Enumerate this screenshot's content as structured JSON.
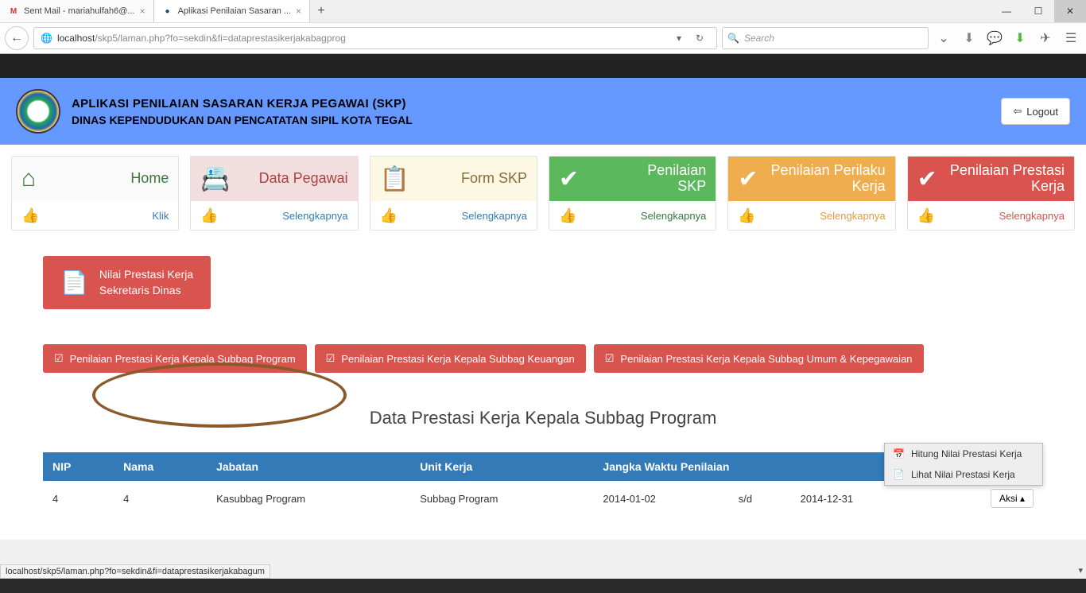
{
  "browser": {
    "tabs": [
      {
        "title": "Sent Mail - mariahulfah6@...",
        "icon": "M"
      },
      {
        "title": "Aplikasi Penilaian Sasaran ...",
        "icon": "●"
      }
    ],
    "url_host": "localhost",
    "url_path": "/skp5/laman.php?fo=sekdin&fi=dataprestasikerjakabagprog",
    "search_placeholder": "Search",
    "statusbar": "localhost/skp5/laman.php?fo=sekdin&fi=dataprestasikerjakabagum"
  },
  "header": {
    "line1": "APLIKASI PENILAIAN SASARAN KERJA PEGAWAI (SKP)",
    "line2": "DINAS KEPENDUDUKAN DAN PENCATATAN SIPIL KOTA TEGAL",
    "logout": "Logout"
  },
  "cards": [
    {
      "title": "Home",
      "link": "Klik",
      "cls": "c-green",
      "icon": "⌂"
    },
    {
      "title": "Data Pegawai",
      "link": "Selengkapnya",
      "cls": "c-red",
      "icon": "📇"
    },
    {
      "title": "Form SKP",
      "link": "Selengkapnya",
      "cls": "c-yellow",
      "icon": "📋"
    },
    {
      "title": "Penilaian SKP",
      "link": "Selengkapnya",
      "cls": "c-success",
      "icon": "✔"
    },
    {
      "title": "Penilaian Perilaku Kerja",
      "link": "Selengkapnya",
      "cls": "c-warn",
      "icon": "✔"
    },
    {
      "title": "Penilaian Prestasi Kerja",
      "link": "Selengkapnya",
      "cls": "c-danger",
      "icon": "✔"
    }
  ],
  "chip": {
    "line1": "Nilai Prestasi Kerja",
    "line2": "Sekretaris Dinas"
  },
  "tabsrow": [
    "Penilaian Prestasi Kerja Kepala Subbag Program",
    "Penilaian Prestasi Kerja Kepala Subbag Keuangan",
    "Penilaian Prestasi Kerja Kepala Subbag Umum & Kepegawaian"
  ],
  "section_title": "Data Prestasi Kerja Kepala Subbag Program",
  "table": {
    "headers": [
      "NIP",
      "Nama",
      "Jabatan",
      "Unit Kerja",
      "Jangka Waktu Penilaian"
    ],
    "row": {
      "nip": "4",
      "nama": "4",
      "jabatan": "Kasubbag Program",
      "unit": "Subbag Program",
      "start": "2014-01-02",
      "sep": "s/d",
      "end": "2014-12-31",
      "aksi": "Aksi"
    }
  },
  "dropdown": {
    "item1": "Hitung Nilai Prestasi Kerja",
    "item2": "Lihat Nilai Prestasi Kerja"
  }
}
